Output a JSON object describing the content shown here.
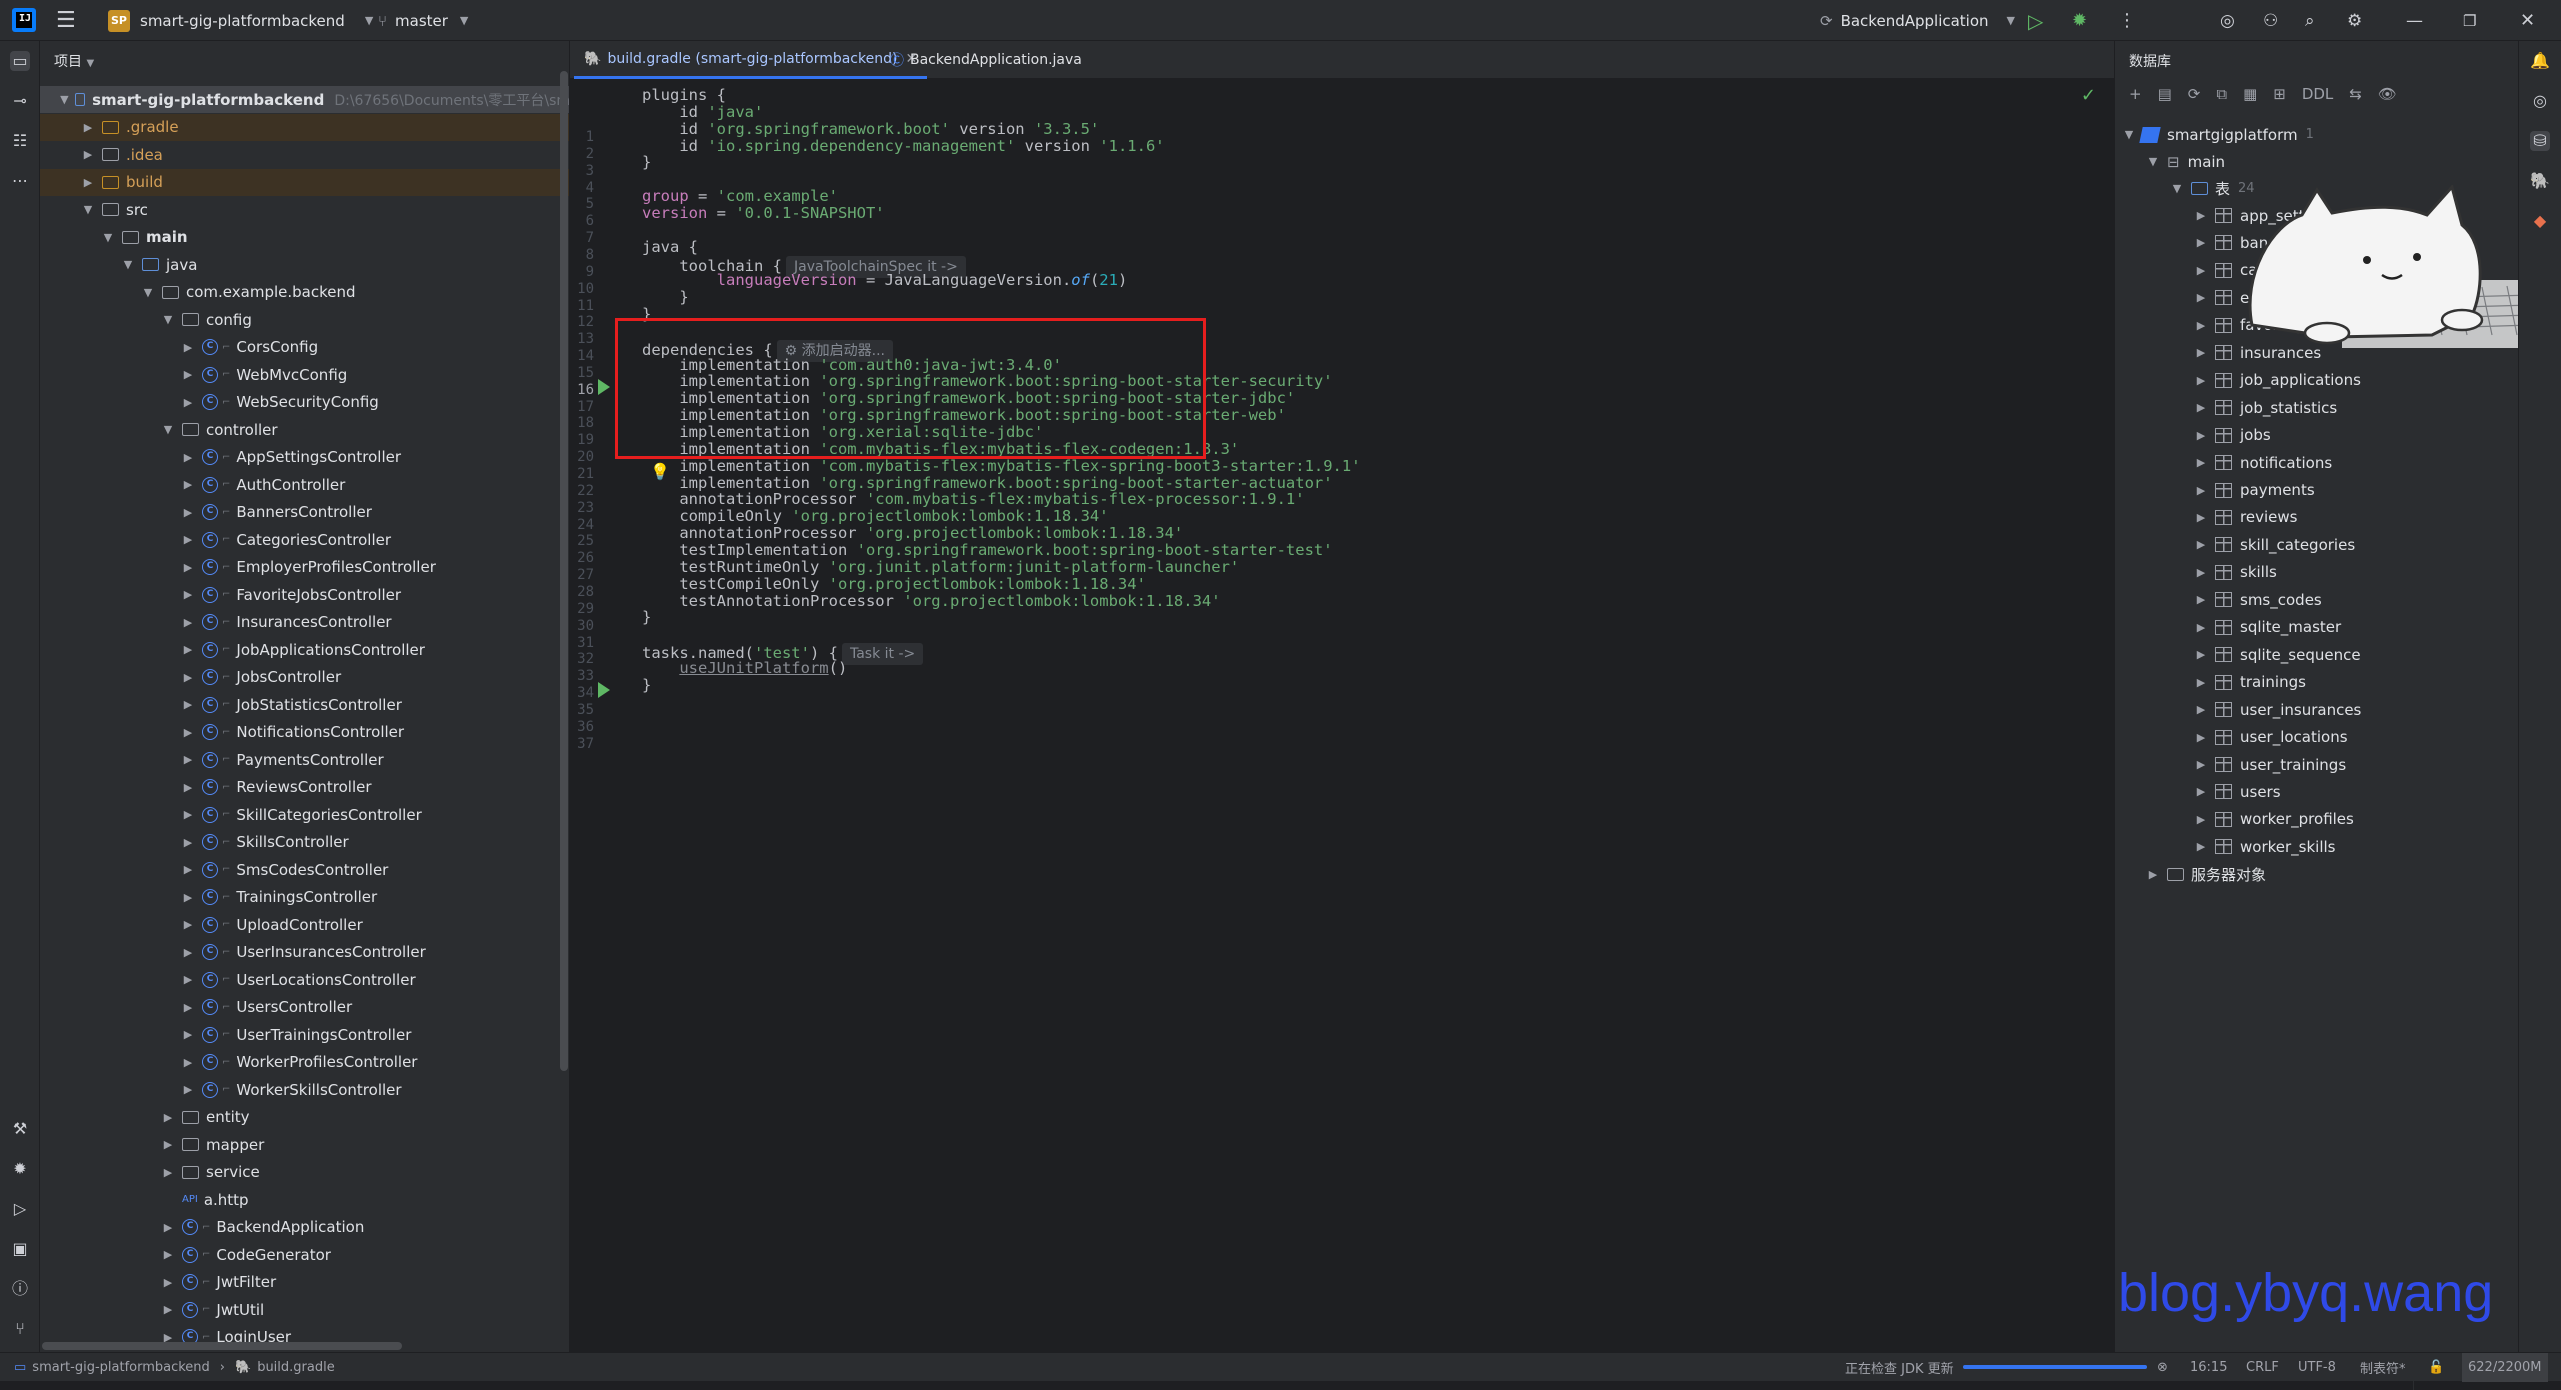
{
  "topbar": {
    "menu_icon": "hamburger-icon",
    "project_badge": "SP",
    "project_name": "smart-gig-platformbackend",
    "branch": "master",
    "run_config": "BackendApplication"
  },
  "project_panel": {
    "title": "项目",
    "root_name": "smart-gig-platformbackend",
    "root_path": "D:\\67656\\Documents\\零工平台\\sm",
    "nodes": [
      {
        "label": ".gradle",
        "depth": 1,
        "kind": "folder-orange",
        "chev": ">",
        "style": "orange"
      },
      {
        "label": ".idea",
        "depth": 1,
        "kind": "folder",
        "chev": ">",
        "style": "orange"
      },
      {
        "label": "build",
        "depth": 1,
        "kind": "folder-orange",
        "chev": ">",
        "style": "orange"
      },
      {
        "label": "src",
        "depth": 1,
        "kind": "folder",
        "chev": "v"
      },
      {
        "label": "main",
        "depth": 2,
        "kind": "folder",
        "chev": "v",
        "style": "bold"
      },
      {
        "label": "java",
        "depth": 3,
        "kind": "folder-blue",
        "chev": "v"
      },
      {
        "label": "com.example.backend",
        "depth": 4,
        "kind": "folder",
        "chev": "v"
      },
      {
        "label": "config",
        "depth": 5,
        "kind": "folder",
        "chev": "v"
      },
      {
        "label": "CorsConfig",
        "depth": 6,
        "kind": "class",
        "chev": ">"
      },
      {
        "label": "WebMvcConfig",
        "depth": 6,
        "kind": "class",
        "chev": ">"
      },
      {
        "label": "WebSecurityConfig",
        "depth": 6,
        "kind": "class",
        "chev": ">"
      },
      {
        "label": "controller",
        "depth": 5,
        "kind": "folder",
        "chev": "v"
      },
      {
        "label": "AppSettingsController",
        "depth": 6,
        "kind": "class",
        "chev": ">"
      },
      {
        "label": "AuthController",
        "depth": 6,
        "kind": "class",
        "chev": ">"
      },
      {
        "label": "BannersController",
        "depth": 6,
        "kind": "class",
        "chev": ">"
      },
      {
        "label": "CategoriesController",
        "depth": 6,
        "kind": "class",
        "chev": ">"
      },
      {
        "label": "EmployerProfilesController",
        "depth": 6,
        "kind": "class",
        "chev": ">"
      },
      {
        "label": "FavoriteJobsController",
        "depth": 6,
        "kind": "class",
        "chev": ">"
      },
      {
        "label": "InsurancesController",
        "depth": 6,
        "kind": "class",
        "chev": ">"
      },
      {
        "label": "JobApplicationsController",
        "depth": 6,
        "kind": "class",
        "chev": ">"
      },
      {
        "label": "JobsController",
        "depth": 6,
        "kind": "class",
        "chev": ">"
      },
      {
        "label": "JobStatisticsController",
        "depth": 6,
        "kind": "class",
        "chev": ">"
      },
      {
        "label": "NotificationsController",
        "depth": 6,
        "kind": "class",
        "chev": ">"
      },
      {
        "label": "PaymentsController",
        "depth": 6,
        "kind": "class",
        "chev": ">"
      },
      {
        "label": "ReviewsController",
        "depth": 6,
        "kind": "class",
        "chev": ">"
      },
      {
        "label": "SkillCategoriesController",
        "depth": 6,
        "kind": "class",
        "chev": ">"
      },
      {
        "label": "SkillsController",
        "depth": 6,
        "kind": "class",
        "chev": ">"
      },
      {
        "label": "SmsCodesController",
        "depth": 6,
        "kind": "class",
        "chev": ">"
      },
      {
        "label": "TrainingsController",
        "depth": 6,
        "kind": "class",
        "chev": ">"
      },
      {
        "label": "UploadController",
        "depth": 6,
        "kind": "class",
        "chev": ">"
      },
      {
        "label": "UserInsurancesController",
        "depth": 6,
        "kind": "class",
        "chev": ">"
      },
      {
        "label": "UserLocationsController",
        "depth": 6,
        "kind": "class",
        "chev": ">"
      },
      {
        "label": "UsersController",
        "depth": 6,
        "kind": "class",
        "chev": ">"
      },
      {
        "label": "UserTrainingsController",
        "depth": 6,
        "kind": "class",
        "chev": ">"
      },
      {
        "label": "WorkerProfilesController",
        "depth": 6,
        "kind": "class",
        "chev": ">"
      },
      {
        "label": "WorkerSkillsController",
        "depth": 6,
        "kind": "class",
        "chev": ">"
      },
      {
        "label": "entity",
        "depth": 5,
        "kind": "folder",
        "chev": ">"
      },
      {
        "label": "mapper",
        "depth": 5,
        "kind": "folder",
        "chev": ">"
      },
      {
        "label": "service",
        "depth": 5,
        "kind": "folder",
        "chev": ">"
      },
      {
        "label": "a.http",
        "depth": 5,
        "kind": "api",
        "chev": ""
      },
      {
        "label": "BackendApplication",
        "depth": 5,
        "kind": "class",
        "chev": ">"
      },
      {
        "label": "CodeGenerator",
        "depth": 5,
        "kind": "class",
        "chev": ">"
      },
      {
        "label": "JwtFilter",
        "depth": 5,
        "kind": "class",
        "chev": ">"
      },
      {
        "label": "JwtUtil",
        "depth": 5,
        "kind": "class",
        "chev": ">"
      },
      {
        "label": "LoginUser",
        "depth": 5,
        "kind": "class",
        "chev": ">"
      }
    ]
  },
  "editor": {
    "tabs": [
      {
        "label": "build.gradle (smart-gig-platformbackend)",
        "active": true
      },
      {
        "label": "BackendApplication.java",
        "active": false
      }
    ],
    "current_line": 16,
    "lines": [
      {
        "n": 1,
        "segs": [
          [
            "",
            "plugins {"
          ]
        ]
      },
      {
        "n": 2,
        "segs": [
          [
            "",
            "    id "
          ],
          [
            "str",
            "'java'"
          ]
        ]
      },
      {
        "n": 3,
        "segs": [
          [
            "",
            "    id "
          ],
          [
            "str",
            "'org.springframework.boot'"
          ],
          [
            "",
            " version "
          ],
          [
            "str",
            "'3.3.5'"
          ]
        ]
      },
      {
        "n": 4,
        "segs": [
          [
            "",
            "    id "
          ],
          [
            "str",
            "'io.spring.dependency-management'"
          ],
          [
            "",
            " version "
          ],
          [
            "str",
            "'1.1.6'"
          ]
        ]
      },
      {
        "n": 5,
        "segs": [
          [
            "",
            "}"
          ]
        ]
      },
      {
        "n": 6,
        "segs": []
      },
      {
        "n": 7,
        "segs": [
          [
            "prop",
            "group"
          ],
          [
            "",
            " = "
          ],
          [
            "str",
            "'com.example'"
          ]
        ]
      },
      {
        "n": 8,
        "segs": [
          [
            "prop",
            "version"
          ],
          [
            "",
            " = "
          ],
          [
            "str",
            "'0.0.1-SNAPSHOT'"
          ]
        ]
      },
      {
        "n": 9,
        "segs": []
      },
      {
        "n": 10,
        "segs": [
          [
            "",
            "java {"
          ]
        ]
      },
      {
        "n": 11,
        "segs": [
          [
            "",
            "    toolchain {"
          ],
          [
            "hint",
            "JavaToolchainSpec it ->"
          ]
        ]
      },
      {
        "n": 12,
        "segs": [
          [
            "prop",
            "        languageVersion"
          ],
          [
            "",
            " = JavaLanguageVersion."
          ],
          [
            "ital",
            "of"
          ],
          [
            "",
            "("
          ],
          [
            "num",
            "21"
          ],
          [
            "",
            ")"
          ]
        ]
      },
      {
        "n": 13,
        "segs": [
          [
            "",
            "    }"
          ]
        ]
      },
      {
        "n": 14,
        "segs": [
          [
            "",
            "}"
          ]
        ]
      },
      {
        "n": 15,
        "segs": []
      },
      {
        "n": 16,
        "segs": [
          [
            "",
            "dependencies {"
          ],
          [
            "hint",
            "⚙ 添加启动器..."
          ]
        ]
      },
      {
        "n": 17,
        "segs": [
          [
            "",
            "    implementation "
          ],
          [
            "str",
            "'com.auth0:java-jwt:3.4.0'"
          ]
        ]
      },
      {
        "n": 18,
        "segs": [
          [
            "",
            "    implementation "
          ],
          [
            "str",
            "'org.springframework.boot:spring-boot-starter-security'"
          ]
        ]
      },
      {
        "n": 19,
        "segs": [
          [
            "",
            "    implementation "
          ],
          [
            "str",
            "'org.springframework.boot:spring-boot-starter-jdbc'"
          ]
        ]
      },
      {
        "n": 20,
        "segs": [
          [
            "",
            "    implementation "
          ],
          [
            "str",
            "'org.springframework.boot:spring-boot-starter-web'"
          ]
        ]
      },
      {
        "n": 21,
        "segs": [
          [
            "",
            "    implementation "
          ],
          [
            "str",
            "'org.xerial:sqlite-jdbc'"
          ]
        ]
      },
      {
        "n": 22,
        "segs": [
          [
            "",
            "    implementation "
          ],
          [
            "str",
            "'com.mybatis-flex:mybatis-flex-codegen:1.8.3'"
          ]
        ]
      },
      {
        "n": 23,
        "segs": [
          [
            "",
            "    implementation "
          ],
          [
            "str",
            "'com.mybatis-flex:mybatis-flex-spring-boot3-starter:1.9.1'"
          ]
        ]
      },
      {
        "n": 24,
        "segs": [
          [
            "",
            "    implementation "
          ],
          [
            "str",
            "'org.springframework.boot:spring-boot-starter-actuator'"
          ]
        ]
      },
      {
        "n": 25,
        "segs": [
          [
            "",
            "    annotationProcessor "
          ],
          [
            "str",
            "'com.mybatis-flex:mybatis-flex-processor:1.9.1'"
          ]
        ]
      },
      {
        "n": 26,
        "segs": [
          [
            "",
            "    compileOnly "
          ],
          [
            "str",
            "'org.projectlombok:lombok:1.18.34'"
          ]
        ]
      },
      {
        "n": 27,
        "segs": [
          [
            "",
            "    annotationProcessor "
          ],
          [
            "str",
            "'org.projectlombok:lombok:1.18.34'"
          ]
        ]
      },
      {
        "n": 28,
        "segs": [
          [
            "",
            "    testImplementation "
          ],
          [
            "str",
            "'org.springframework.boot:spring-boot-starter-test'"
          ]
        ]
      },
      {
        "n": 29,
        "segs": [
          [
            "",
            "    testRuntimeOnly "
          ],
          [
            "str",
            "'org.junit.platform:junit-platform-launcher'"
          ]
        ]
      },
      {
        "n": 30,
        "segs": [
          [
            "",
            "    testCompileOnly "
          ],
          [
            "str",
            "'org.projectlombok:lombok:1.18.34'"
          ]
        ]
      },
      {
        "n": 31,
        "segs": [
          [
            "",
            "    testAnnotationProcessor "
          ],
          [
            "str",
            "'org.projectlombok:lombok:1.18.34'"
          ]
        ]
      },
      {
        "n": 32,
        "segs": [
          [
            "",
            "}"
          ]
        ]
      },
      {
        "n": 33,
        "segs": []
      },
      {
        "n": 34,
        "segs": [
          [
            "",
            "tasks.named("
          ],
          [
            "str",
            "'test'"
          ],
          [
            "",
            ") {"
          ],
          [
            "hint",
            "Task it ->"
          ]
        ]
      },
      {
        "n": 35,
        "segs": [
          [
            "",
            "    "
          ],
          [
            "u",
            "useJUnitPlatform"
          ],
          [
            "",
            "()"
          ]
        ]
      },
      {
        "n": 36,
        "segs": [
          [
            "",
            "}"
          ]
        ]
      },
      {
        "n": 37,
        "segs": []
      }
    ],
    "run_gutter_lines": [
      16,
      34
    ]
  },
  "database_panel": {
    "title": "数据库",
    "toolbar": [
      "+",
      "▤",
      "⟳",
      "⧉",
      "▦",
      "⊞",
      "DDL",
      "⇆",
      "👁"
    ],
    "datasource": {
      "name": "smartgigplatform",
      "count": "1"
    },
    "schema": "main",
    "tables_group": {
      "label": "表",
      "count": "24"
    },
    "tables": [
      "app_settings",
      "banners",
      "categories",
      "employer_profiles",
      "favorite_jobs",
      "insurances",
      "job_applications",
      "job_statistics",
      "jobs",
      "notifications",
      "payments",
      "reviews",
      "skill_categories",
      "skills",
      "sms_codes",
      "sqlite_master",
      "sqlite_sequence",
      "trainings",
      "user_insurances",
      "user_locations",
      "user_trainings",
      "users",
      "worker_profiles",
      "worker_skills"
    ],
    "server_objects": "服务器对象"
  },
  "watermark": "blog.ybyq.wang",
  "statusbar": {
    "breadcrumb_project": "smart-gig-platformbackend",
    "breadcrumb_file": "build.gradle",
    "task_text": "正在检查 JDK 更新",
    "position": "16:15",
    "line_ending": "CRLF",
    "encoding": "UTF-8",
    "indent": "制表符*",
    "memory": "622/2200M"
  },
  "colors": {
    "accent": "#3574f0",
    "highlight_box": "#e61e1e",
    "run": "#5fb865",
    "string": "#6aab73",
    "property": "#c77dbb"
  }
}
